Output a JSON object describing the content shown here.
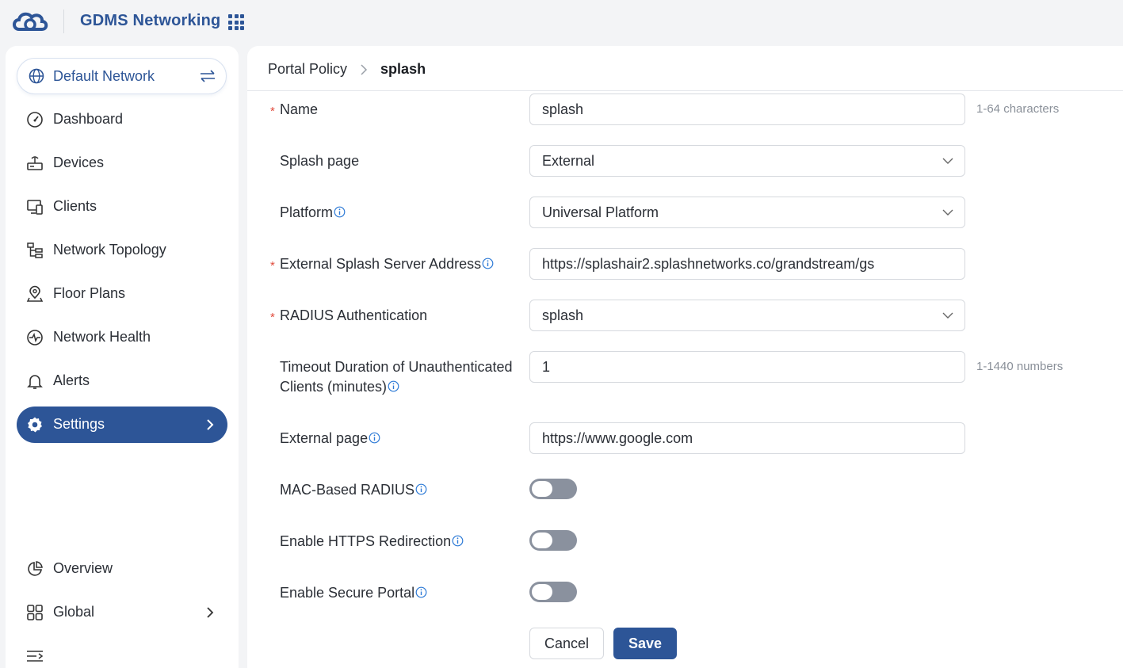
{
  "app": {
    "title": "GDMS Networking"
  },
  "network": {
    "name": "Default Network"
  },
  "nav": {
    "items": [
      {
        "key": "dashboard",
        "label": "Dashboard"
      },
      {
        "key": "devices",
        "label": "Devices"
      },
      {
        "key": "clients",
        "label": "Clients"
      },
      {
        "key": "topology",
        "label": "Network Topology"
      },
      {
        "key": "floorplans",
        "label": "Floor Plans"
      },
      {
        "key": "health",
        "label": "Network Health"
      },
      {
        "key": "alerts",
        "label": "Alerts"
      },
      {
        "key": "settings",
        "label": "Settings",
        "active": true
      }
    ],
    "bottom": [
      {
        "key": "overview",
        "label": "Overview"
      },
      {
        "key": "global",
        "label": "Global"
      }
    ]
  },
  "breadcrumb": {
    "parent": "Portal Policy",
    "current": "splash"
  },
  "form": {
    "name": {
      "label": "Name",
      "value": "splash",
      "hint": "1-64 characters",
      "required": true
    },
    "splash_page": {
      "label": "Splash page",
      "value": "External"
    },
    "platform": {
      "label": "Platform",
      "value": "Universal Platform"
    },
    "external_server": {
      "label": "External Splash Server Address",
      "value": "https://splashair2.splashnetworks.co/grandstream/gs",
      "required": true
    },
    "radius_auth": {
      "label": "RADIUS Authentication",
      "value": "splash",
      "required": true
    },
    "timeout": {
      "label_line1": "Timeout Duration of Unauthenticated",
      "label_line2": "Clients (minutes)",
      "value": "1",
      "hint": "1-1440 numbers"
    },
    "external_page": {
      "label": "External page",
      "value": "https://www.google.com"
    },
    "mac_radius": {
      "label": "MAC-Based RADIUS",
      "enabled": false
    },
    "https_redirect": {
      "label": "Enable HTTPS Redirection",
      "enabled": false
    },
    "secure_portal": {
      "label": "Enable Secure Portal",
      "enabled": false
    }
  },
  "buttons": {
    "cancel": "Cancel",
    "save": "Save"
  },
  "colors": {
    "accent": "#2d5597",
    "required": "#e04a3b",
    "toggle_off": "#8a919e"
  }
}
